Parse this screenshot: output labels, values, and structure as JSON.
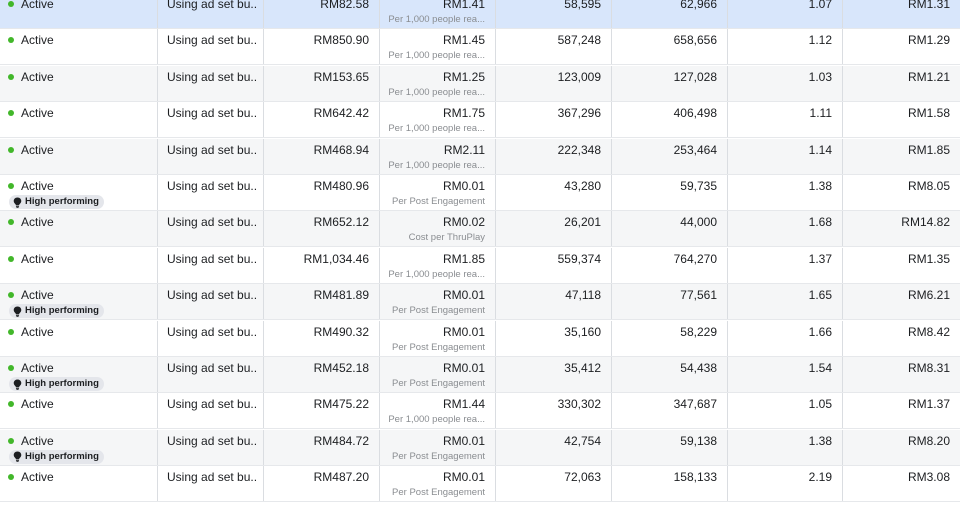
{
  "colors": {
    "active_dot": "#42b72a",
    "selected_row": "#d8e6fb",
    "alt_row": "#f5f6f7"
  },
  "rows": [
    {
      "status": "Active",
      "badge": "",
      "budget": "Using ad set bu...",
      "spent": "RM82.58",
      "cpr": "RM1.41",
      "cpr_label": "Per 1,000 people rea...",
      "reach": "58,595",
      "impressions": "62,966",
      "frequency": "1.07",
      "cpm": "RM1.31"
    },
    {
      "status": "Active",
      "badge": "",
      "budget": "Using ad set bu...",
      "spent": "RM850.90",
      "cpr": "RM1.45",
      "cpr_label": "Per 1,000 people rea...",
      "reach": "587,248",
      "impressions": "658,656",
      "frequency": "1.12",
      "cpm": "RM1.29"
    },
    {
      "status": "Active",
      "badge": "",
      "budget": "Using ad set bu...",
      "spent": "RM153.65",
      "cpr": "RM1.25",
      "cpr_label": "Per 1,000 people rea...",
      "reach": "123,009",
      "impressions": "127,028",
      "frequency": "1.03",
      "cpm": "RM1.21"
    },
    {
      "status": "Active",
      "badge": "",
      "budget": "Using ad set bu...",
      "spent": "RM642.42",
      "cpr": "RM1.75",
      "cpr_label": "Per 1,000 people rea...",
      "reach": "367,296",
      "impressions": "406,498",
      "frequency": "1.11",
      "cpm": "RM1.58"
    },
    {
      "status": "Active",
      "badge": "",
      "budget": "Using ad set bu...",
      "spent": "RM468.94",
      "cpr": "RM2.11",
      "cpr_label": "Per 1,000 people rea...",
      "reach": "222,348",
      "impressions": "253,464",
      "frequency": "1.14",
      "cpm": "RM1.85"
    },
    {
      "status": "Active",
      "badge": "High performing",
      "budget": "Using ad set bu...",
      "spent": "RM480.96",
      "cpr": "RM0.01",
      "cpr_label": "Per Post Engagement",
      "reach": "43,280",
      "impressions": "59,735",
      "frequency": "1.38",
      "cpm": "RM8.05"
    },
    {
      "status": "Active",
      "badge": "",
      "budget": "Using ad set bu...",
      "spent": "RM652.12",
      "cpr": "RM0.02",
      "cpr_label": "Cost per ThruPlay",
      "reach": "26,201",
      "impressions": "44,000",
      "frequency": "1.68",
      "cpm": "RM14.82"
    },
    {
      "status": "Active",
      "badge": "",
      "budget": "Using ad set bu...",
      "spent": "RM1,034.46",
      "cpr": "RM1.85",
      "cpr_label": "Per 1,000 people rea...",
      "reach": "559,374",
      "impressions": "764,270",
      "frequency": "1.37",
      "cpm": "RM1.35"
    },
    {
      "status": "Active",
      "badge": "High performing",
      "budget": "Using ad set bu...",
      "spent": "RM481.89",
      "cpr": "RM0.01",
      "cpr_label": "Per Post Engagement",
      "reach": "47,118",
      "impressions": "77,561",
      "frequency": "1.65",
      "cpm": "RM6.21"
    },
    {
      "status": "Active",
      "badge": "",
      "budget": "Using ad set bu...",
      "spent": "RM490.32",
      "cpr": "RM0.01",
      "cpr_label": "Per Post Engagement",
      "reach": "35,160",
      "impressions": "58,229",
      "frequency": "1.66",
      "cpm": "RM8.42"
    },
    {
      "status": "Active",
      "badge": "High performing",
      "budget": "Using ad set bu...",
      "spent": "RM452.18",
      "cpr": "RM0.01",
      "cpr_label": "Per Post Engagement",
      "reach": "35,412",
      "impressions": "54,438",
      "frequency": "1.54",
      "cpm": "RM8.31"
    },
    {
      "status": "Active",
      "badge": "",
      "budget": "Using ad set bu...",
      "spent": "RM475.22",
      "cpr": "RM1.44",
      "cpr_label": "Per 1,000 people rea...",
      "reach": "330,302",
      "impressions": "347,687",
      "frequency": "1.05",
      "cpm": "RM1.37"
    },
    {
      "status": "Active",
      "badge": "High performing",
      "budget": "Using ad set bu...",
      "spent": "RM484.72",
      "cpr": "RM0.01",
      "cpr_label": "Per Post Engagement",
      "reach": "42,754",
      "impressions": "59,138",
      "frequency": "1.38",
      "cpm": "RM8.20"
    },
    {
      "status": "Active",
      "badge": "",
      "budget": "Using ad set bu...",
      "spent": "RM487.20",
      "cpr": "RM0.01",
      "cpr_label": "Per Post Engagement",
      "reach": "72,063",
      "impressions": "158,133",
      "frequency": "2.19",
      "cpm": "RM3.08"
    }
  ]
}
